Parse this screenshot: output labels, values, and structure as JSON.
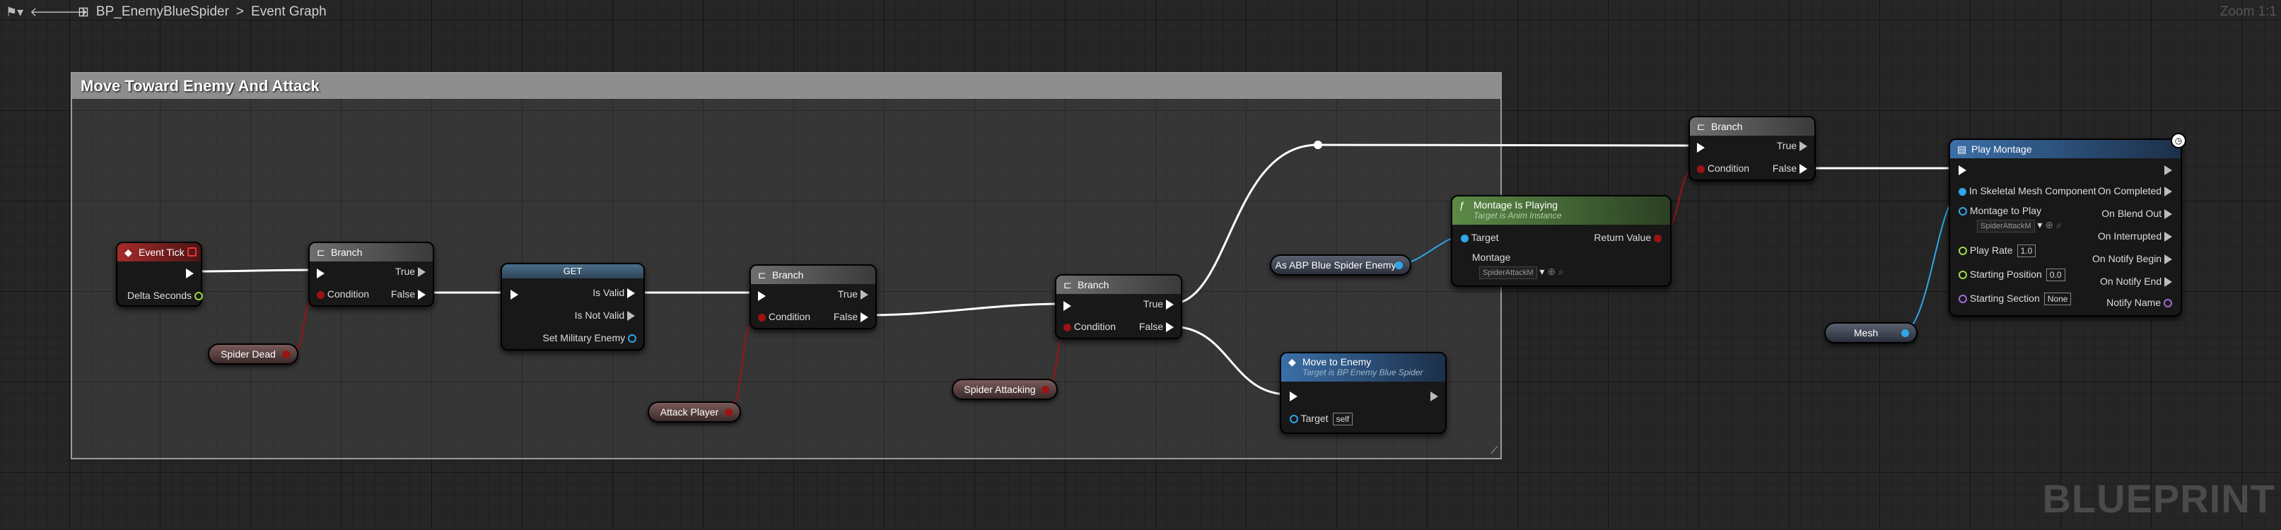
{
  "toolbar": {
    "back_icon": "back-arrow",
    "forward_icon": "forward-arrow",
    "breadcrumb_blueprint": "BP_EnemyBlueSpider",
    "breadcrumb_separator": ">",
    "breadcrumb_graph": "Event Graph",
    "zoom": "Zoom 1:1"
  },
  "watermark": "BLUEPRINT",
  "comment": {
    "title": "Move Toward Enemy And Attack"
  },
  "nodes": {
    "event_tick": {
      "title": "Event Tick",
      "delta": "Delta Seconds"
    },
    "branch1": {
      "title": "Branch",
      "true": "True",
      "false": "False",
      "condition": "Condition"
    },
    "spider_dead": {
      "label": "Spider Dead"
    },
    "get": {
      "title": "GET",
      "is_valid": "Is Valid",
      "is_not_valid": "Is Not Valid",
      "set_military": "Set Military Enemy"
    },
    "branch2": {
      "title": "Branch",
      "true": "True",
      "false": "False",
      "condition": "Condition"
    },
    "attack_player": {
      "label": "Attack Player"
    },
    "branch3": {
      "title": "Branch",
      "true": "True",
      "false": "False",
      "condition": "Condition"
    },
    "spider_attacking": {
      "label": "Spider Attacking"
    },
    "as_abp": {
      "label": "As ABP Blue Spider Enemy"
    },
    "montage_is_playing": {
      "title": "Montage Is Playing",
      "subtitle": "Target is Anim Instance",
      "target": "Target",
      "return_value": "Return Value",
      "montage": "Montage",
      "montage_value": "SpiderAttackM"
    },
    "move_to_enemy": {
      "title": "Move to Enemy",
      "subtitle": "Target is BP Enemy Blue Spider",
      "target": "Target",
      "target_value": "self"
    },
    "branch4": {
      "title": "Branch",
      "true": "True",
      "false": "False",
      "condition": "Condition"
    },
    "mesh": {
      "label": "Mesh"
    },
    "play_montage": {
      "title": "Play Montage",
      "in_skeletal": "In Skeletal Mesh Component",
      "montage_to_play": "Montage to Play",
      "montage_value": "SpiderAttackM",
      "play_rate": "Play Rate",
      "play_rate_value": "1.0",
      "starting_position": "Starting Position",
      "starting_position_value": "0.0",
      "starting_section": "Starting Section",
      "starting_section_value": "None",
      "on_completed": "On Completed",
      "on_blend_out": "On Blend Out",
      "on_interrupted": "On Interrupted",
      "on_notify_begin": "On Notify Begin",
      "on_notify_end": "On Notify End",
      "notify_name": "Notify Name"
    }
  },
  "colors": {
    "exec_wire": "#ffffff",
    "bool_wire": "#9d1212",
    "object_wire": "#2fa6ea"
  }
}
